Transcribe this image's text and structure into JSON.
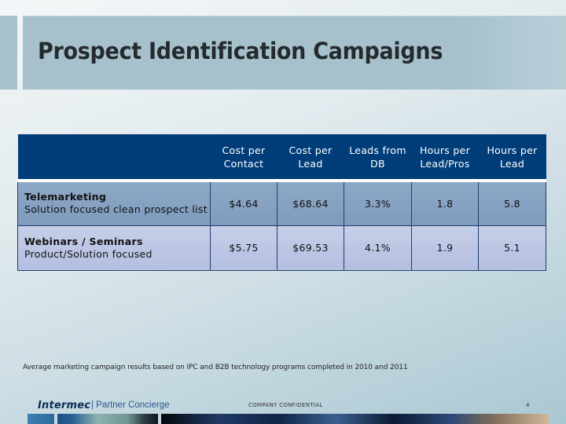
{
  "slide": {
    "title": "Prospect Identification Campaigns",
    "footnote": "Average marketing campaign results based on IPC and B2B technology programs completed in 2010 and 2011",
    "page_number": "4"
  },
  "table": {
    "headers": [
      "",
      "Cost per Contact",
      "Cost per Lead",
      "Leads from DB",
      "Hours per Lead/Pros",
      "Hours per Lead"
    ],
    "header_lines": [
      [
        "",
        ""
      ],
      [
        "Cost per",
        "Contact"
      ],
      [
        "Cost per",
        "Lead"
      ],
      [
        "Leads from",
        "DB"
      ],
      [
        "Hours per",
        "Lead/Pros"
      ],
      [
        "Hours per",
        "Lead"
      ]
    ],
    "rows": [
      {
        "name": "Telemarketing",
        "description": "Solution focused clean prospect list",
        "values": [
          "$4.64",
          "$68.64",
          "3.3%",
          "1.8",
          "5.8"
        ]
      },
      {
        "name": "Webinars / Seminars",
        "description": "Product/Solution focused",
        "values": [
          "$5.75",
          "$69.53",
          "4.1%",
          "1.9",
          "5.1"
        ]
      }
    ]
  },
  "footer": {
    "logo_text": "Intermec",
    "brand_tagline": "| Partner Concierge",
    "confidential": "COMPANY CONFIDENTIAL"
  },
  "colors": {
    "header_bg": "#003d79",
    "row1_bg": "#8ea8c6",
    "row2_bg": "#c6cfe8",
    "title_band": "#a6c1cc"
  }
}
